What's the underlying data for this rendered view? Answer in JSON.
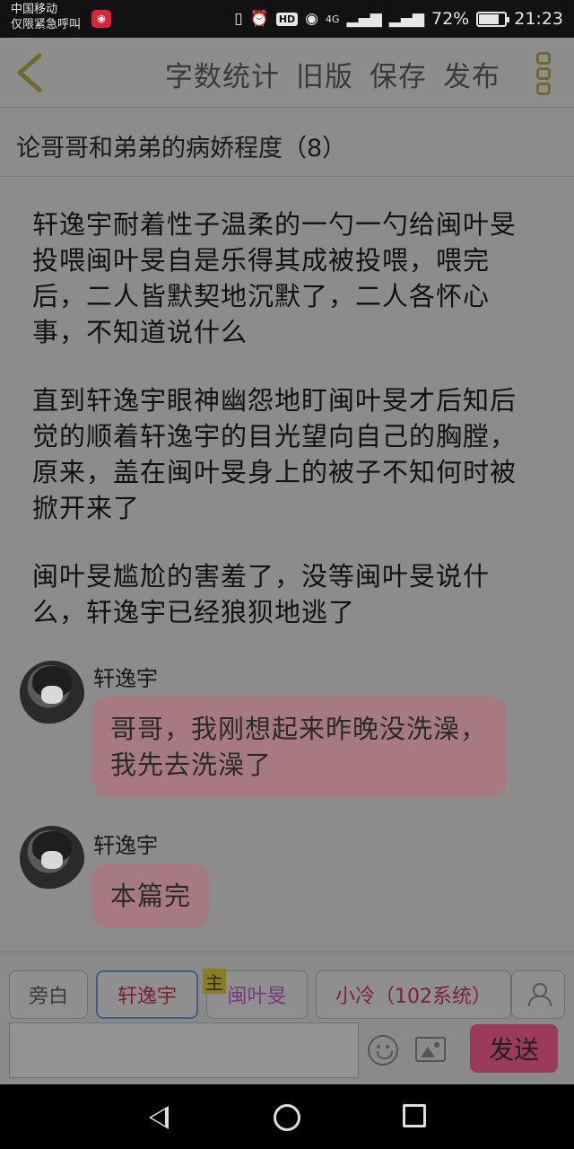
{
  "status_bar": {
    "carrier_line1": "中国移动",
    "carrier_line2": "仅限紧急呼叫",
    "network": "4G",
    "battery": "72%",
    "time": "21:23"
  },
  "header": {
    "actions": [
      "字数统计",
      "旧版",
      "保存",
      "发布"
    ]
  },
  "story": {
    "title": "论哥哥和弟弟的病娇程度（8）",
    "paragraphs": [
      "轩逸宇耐着性子温柔的一勺一勺给闽叶旻投喂闽叶旻自是乐得其成被投喂，喂完后，二人皆默契地沉默了，二人各怀心事，不知道说什么",
      "直到轩逸宇眼神幽怨地盯闽叶旻才后知后觉的顺着轩逸宇的目光望向自己的胸膛，原来，盖在闽叶旻身上的被子不知何时被掀开来了",
      "闽叶旻尴尬的害羞了，没等闽叶旻说什么，轩逸宇已经狼狈地逃了"
    ],
    "messages": [
      {
        "speaker": "轩逸宇",
        "text": "哥哥，我刚想起来昨晚没洗澡，我先去洗澡了"
      },
      {
        "speaker": "轩逸宇",
        "text": "本篇完"
      }
    ]
  },
  "roles": {
    "items": [
      "旁白",
      "轩逸宇",
      "闽叶旻",
      "小冷（102系统）"
    ],
    "main_badge": "主",
    "selected": "轩逸宇"
  },
  "composer": {
    "placeholder": "",
    "send_label": "发送"
  }
}
